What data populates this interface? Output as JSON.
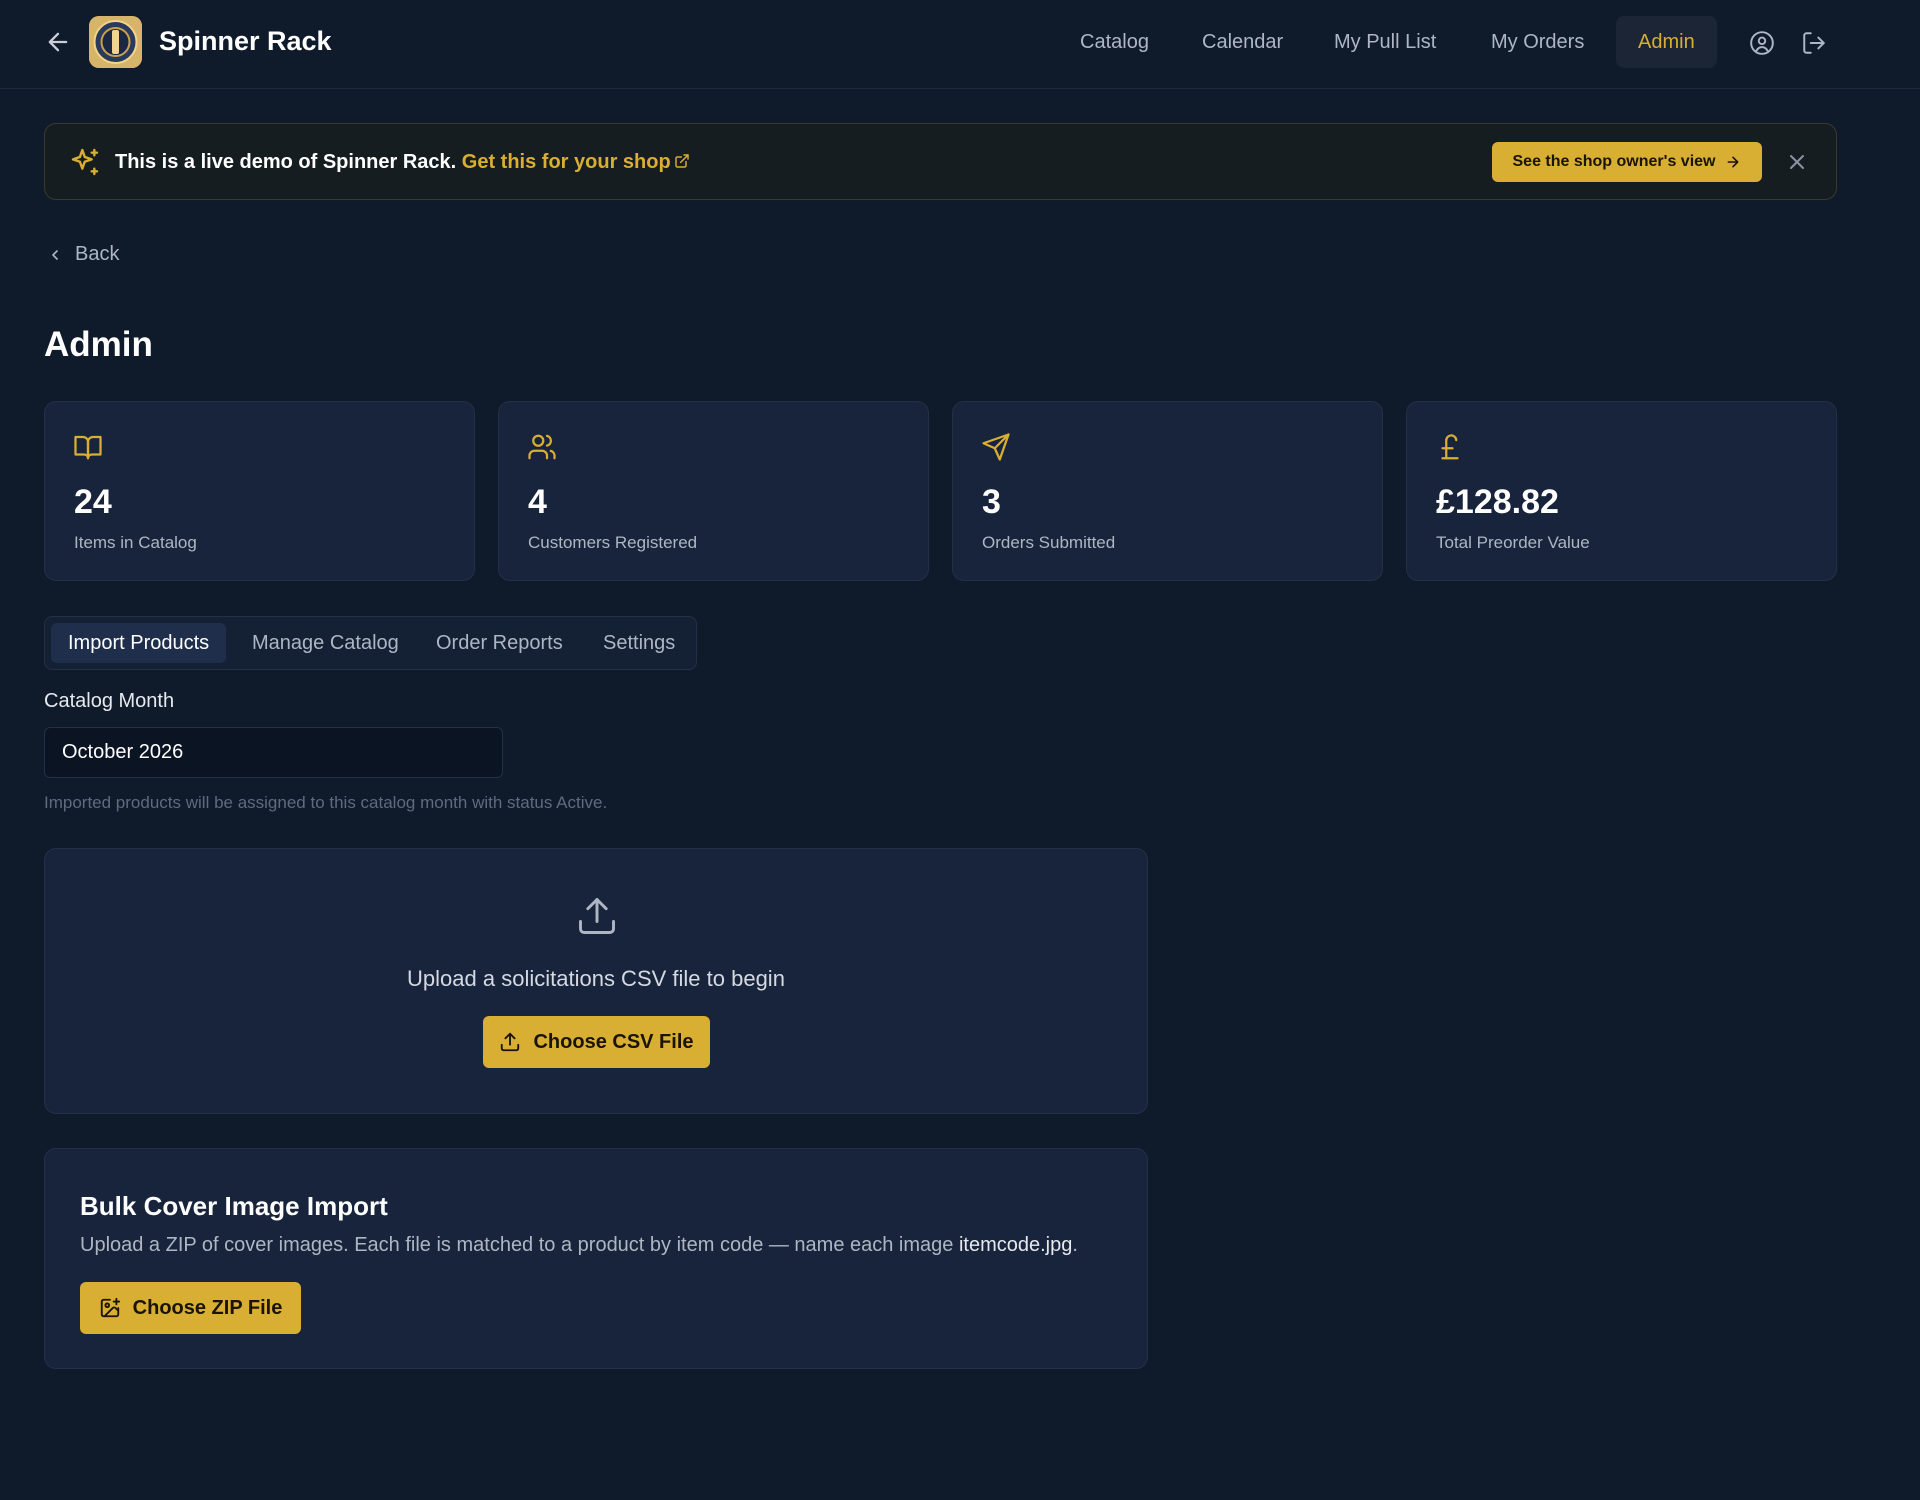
{
  "header": {
    "brand": "Spinner Rack",
    "nav": [
      {
        "label": "Catalog"
      },
      {
        "label": "Calendar"
      },
      {
        "label": "My Pull List"
      },
      {
        "label": "My Orders"
      },
      {
        "label": "Admin",
        "active": true
      }
    ]
  },
  "banner": {
    "text": "This is a live demo of Spinner Rack.",
    "link": "Get this for your shop",
    "button": "See the shop owner's view"
  },
  "back": "Back",
  "page_title": "Admin",
  "stats": [
    {
      "icon": "book-open-icon",
      "value": "24",
      "label": "Items in Catalog"
    },
    {
      "icon": "users-icon",
      "value": "4",
      "label": "Customers Registered"
    },
    {
      "icon": "send-icon",
      "value": "3",
      "label": "Orders Submitted"
    },
    {
      "icon": "pound-icon",
      "value": "£128.82",
      "label": "Total Preorder Value"
    }
  ],
  "tabs": [
    {
      "label": "Import Products",
      "active": true
    },
    {
      "label": "Manage Catalog"
    },
    {
      "label": "Order Reports"
    },
    {
      "label": "Settings"
    }
  ],
  "catalog_month": {
    "label": "Catalog Month",
    "value": "October 2026",
    "hint": "Imported products will be assigned to this catalog month with status Active."
  },
  "upload": {
    "message": "Upload a solicitations CSV file to begin",
    "button": "Choose CSV File"
  },
  "zip": {
    "title": "Bulk Cover Image Import",
    "desc_prefix": "Upload a ZIP of cover images. Each file is matched to a product by item code — name each image ",
    "desc_code": "itemcode.jpg",
    "desc_suffix": ".",
    "button": "Choose ZIP File"
  },
  "colors": {
    "accent": "#d8ae33",
    "background": "#0f1a2b",
    "card": "#18243b"
  }
}
